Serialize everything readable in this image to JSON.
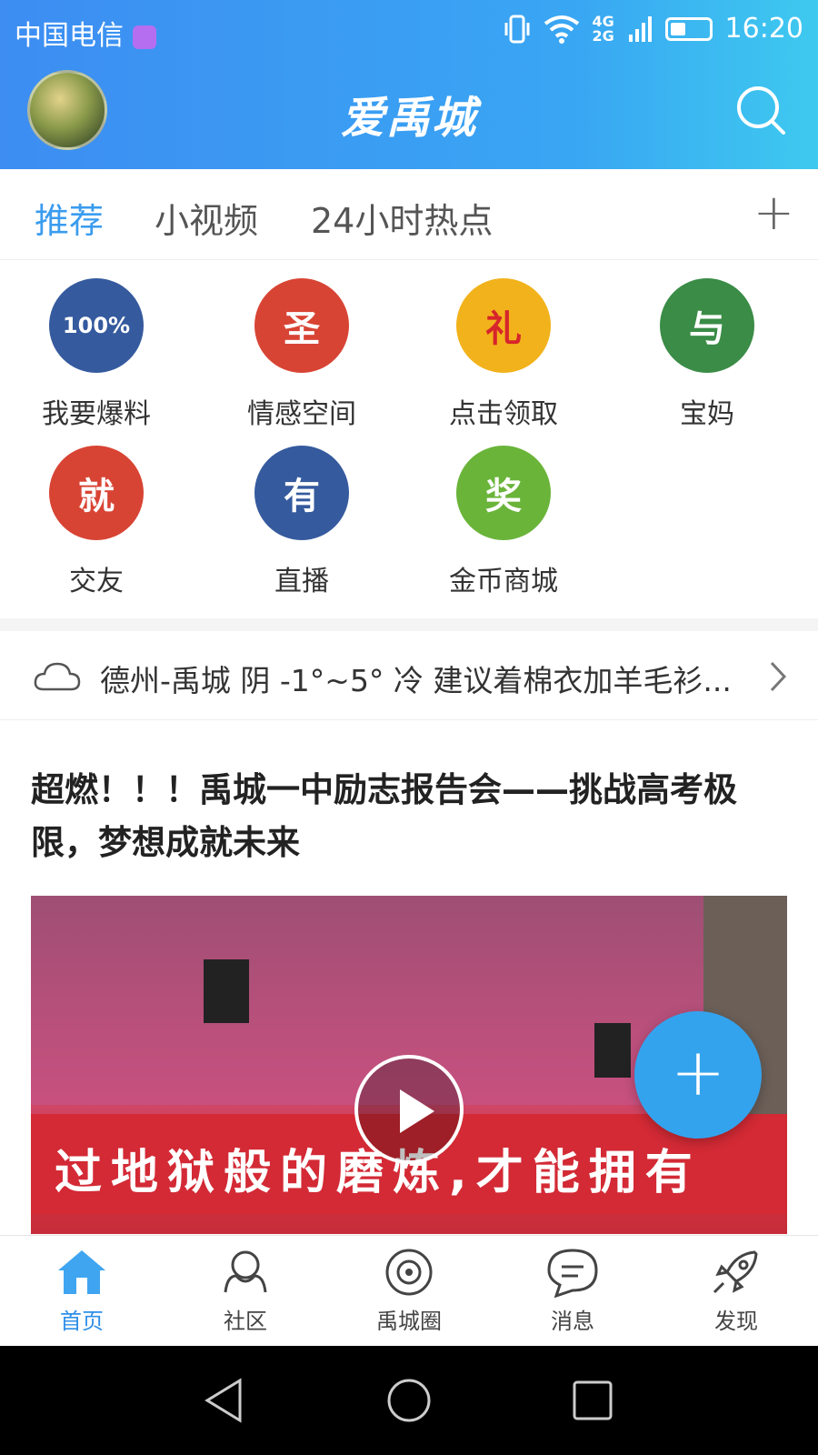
{
  "status_bar": {
    "carrier": "中国电信",
    "network": "4G 2G",
    "time": "16:20"
  },
  "header": {
    "logo_text": "爱禹城",
    "search_icon": "search-icon"
  },
  "tabs": [
    {
      "label": "推荐",
      "active": true
    },
    {
      "label": "小视频",
      "active": false
    },
    {
      "label": "24小时热点",
      "active": false
    }
  ],
  "tab_add_icon": "plus-icon",
  "shortcuts": [
    {
      "label": "我要爆料",
      "glyph": "100%",
      "color": "#355a9e"
    },
    {
      "label": "情感空间",
      "glyph": "圣",
      "color": "#d84434"
    },
    {
      "label": "点击领取",
      "glyph": "礼",
      "color": "#f2b21b"
    },
    {
      "label": "宝妈",
      "glyph": "与",
      "color": "#3a8c46"
    },
    {
      "label": "交友",
      "glyph": "就",
      "color": "#d84434"
    },
    {
      "label": "直播",
      "glyph": "有",
      "color": "#355a9e"
    },
    {
      "label": "金币商城",
      "glyph": "奖",
      "color": "#6ab43a"
    }
  ],
  "weather": {
    "icon": "cloud-icon",
    "text": "德州-禹城 阴 -1°~5° 冷 建议着棉衣加羊毛衫...",
    "arrow_icon": "chevron-right-icon"
  },
  "article": {
    "title": "超燃！！！禹城一中励志报告会——挑战高考极限，梦想成就未来",
    "video_banner": "过地狱般的磨炼,才能拥有",
    "play_icon": "play-icon"
  },
  "fab": {
    "icon": "plus-icon"
  },
  "bottom_nav": [
    {
      "label": "首页",
      "icon": "home-icon",
      "active": true
    },
    {
      "label": "社区",
      "icon": "community-icon",
      "active": false
    },
    {
      "label": "禹城圈",
      "icon": "circle-icon",
      "active": false
    },
    {
      "label": "消息",
      "icon": "message-icon",
      "active": false
    },
    {
      "label": "发现",
      "icon": "rocket-icon",
      "active": false
    }
  ],
  "colors": {
    "brand": "#3a9cef",
    "header_gradient_start": "#3d8df2",
    "header_gradient_end": "#3ec9ef"
  }
}
